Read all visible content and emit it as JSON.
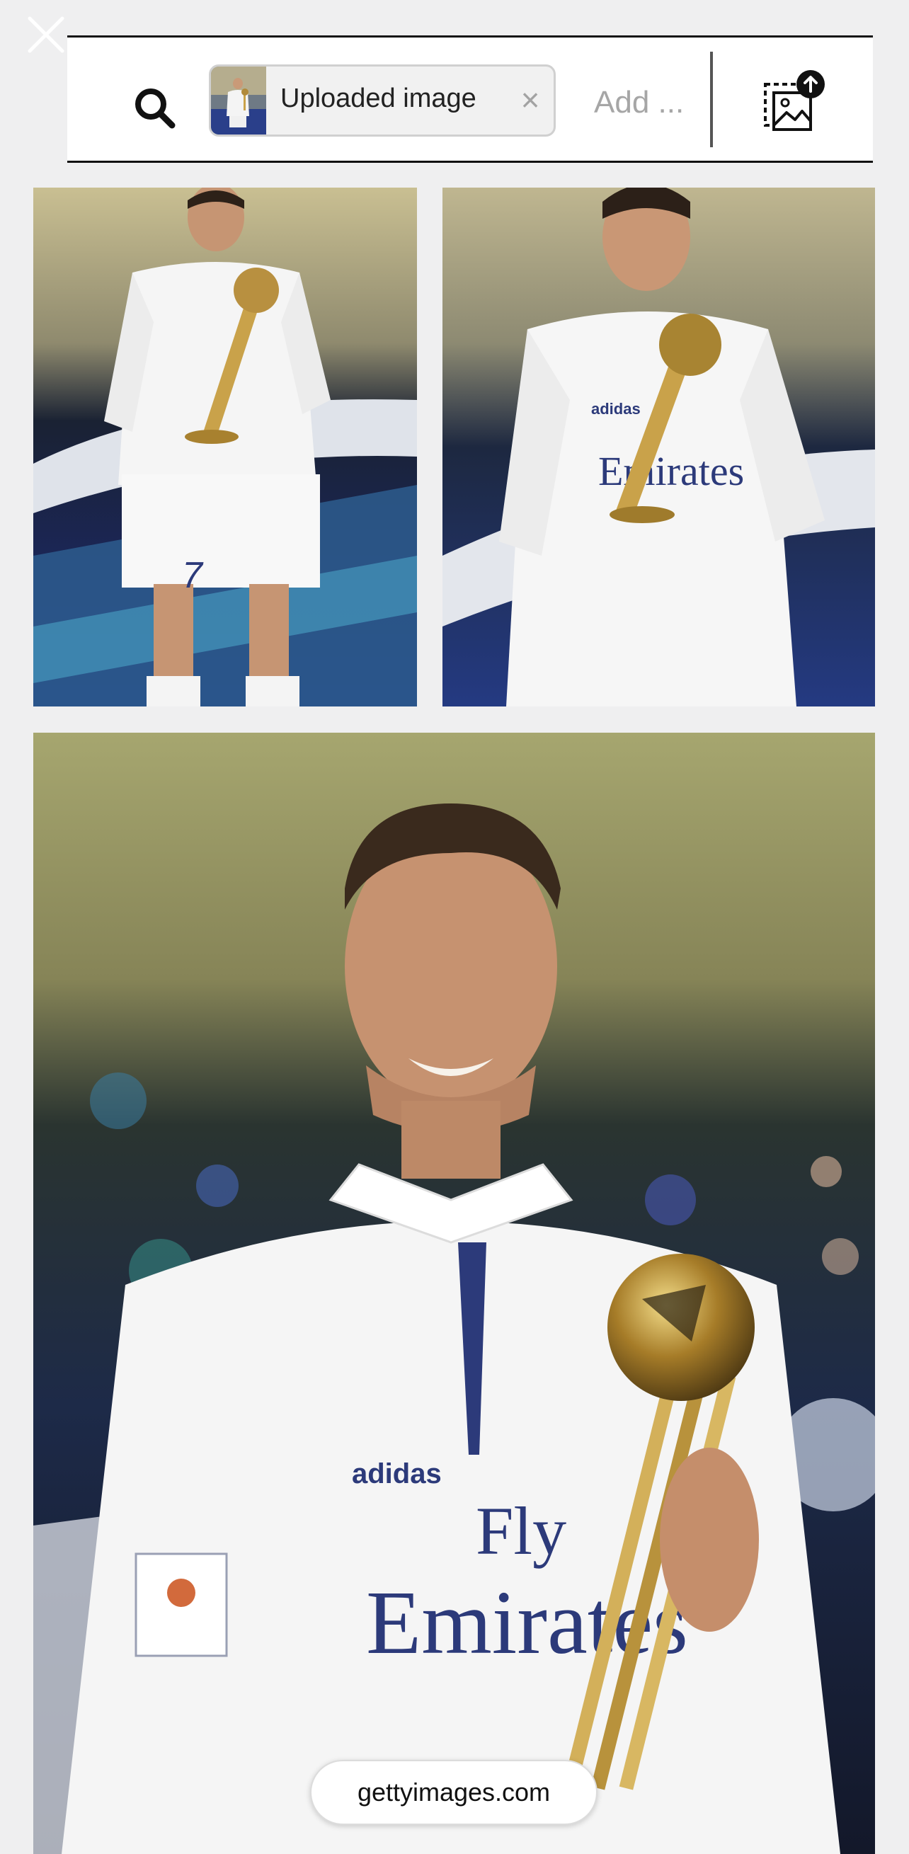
{
  "search": {
    "chip_label": "Uploaded image",
    "chip_remove": "×",
    "add_placeholder": "Add ..."
  },
  "results": [
    {
      "alt": "Football player in white kit holding golden ball trophy, full body"
    },
    {
      "alt": "Football player holding golden ball trophy, mid shot"
    },
    {
      "alt": "Football player smiling with golden ball trophy, close-up"
    }
  ],
  "card_texts": {
    "number": "7",
    "brand": "adidas",
    "sponsor_top": "Fly",
    "sponsor_bottom": "Emirates"
  },
  "source": {
    "label": "gettyimages.com"
  },
  "colors": {
    "page_bg": "#efeff0",
    "chip_bg": "#f1f1f1",
    "placeholder": "#a6a6a6",
    "jersey_text": "#2c3a7a",
    "trophy_gold": "#c9a24a"
  },
  "icons": {
    "close": "close-icon",
    "search": "search-icon",
    "upload": "image-upload-icon",
    "chip_remove": "close-icon"
  }
}
